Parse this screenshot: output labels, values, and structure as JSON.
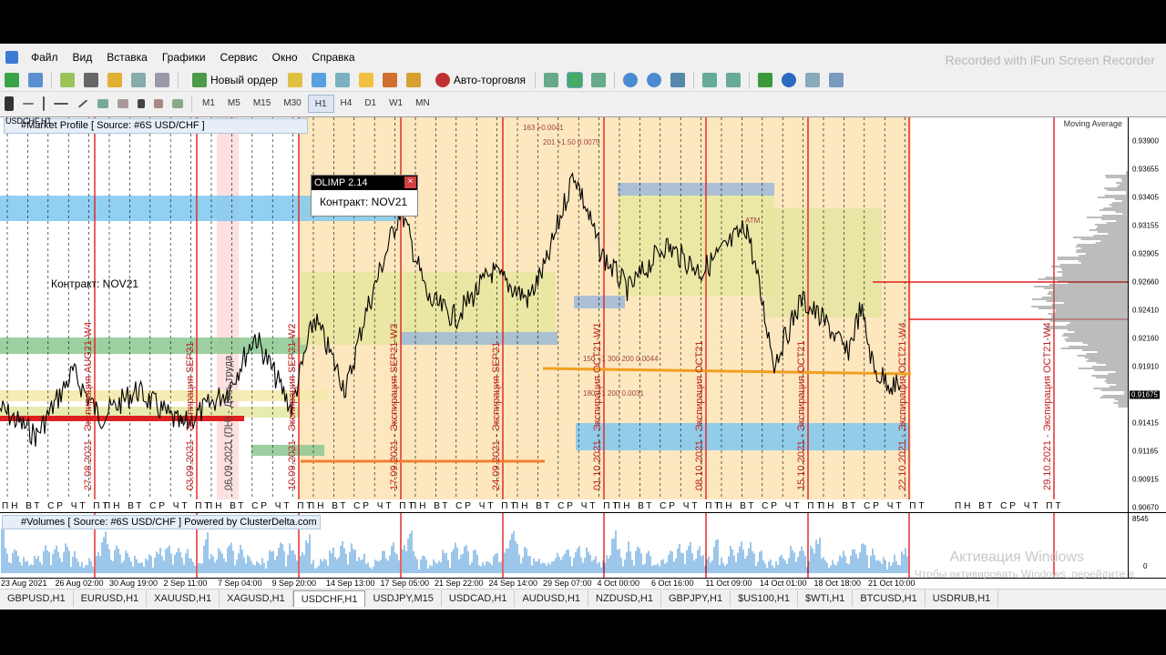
{
  "watermark": "Recorded with iFun Screen Recorder",
  "menu": [
    "Файл",
    "Вид",
    "Вставка",
    "Графики",
    "Сервис",
    "Окно",
    "Справка"
  ],
  "toolbar": {
    "new_order": "Новый ордер",
    "auto_trading": "Авто-торговля"
  },
  "timeframes": [
    "M1",
    "M5",
    "M15",
    "M30",
    "H1",
    "H4",
    "D1",
    "W1",
    "MN"
  ],
  "active_timeframe": "H1",
  "chart_symbol": "USDCHF,H1",
  "market_profile_title": "#Market Profile [ Source: #6S USD/CHF ]",
  "olimp": {
    "title": "OLIMP 2.14",
    "contract": "Контракт: NOV21"
  },
  "contract_label_left": "Контракт: NOV21",
  "moving_average_label": "Moving Average",
  "volumes_title": "#Volumes [ Source: #6S USD/CHF ] Powered by ClusterDelta.com",
  "price_labels": [
    "0.93900",
    "0.93655",
    "0.93405",
    "0.93155",
    "0.92905",
    "0.92660",
    "0.92410",
    "0.92160",
    "0.91910",
    "0.91675",
    "0.91415",
    "0.91165",
    "0.90915",
    "0.90670"
  ],
  "current_price": "0.91675",
  "volume_axis": {
    "max": "8545",
    "min": "0"
  },
  "time_labels": [
    "23 Aug 2021",
    "26 Aug 02:00",
    "30 Aug 19:00",
    "2 Sep 11:00",
    "7 Sep 04:00",
    "9 Sep 20:00",
    "14 Sep 13:00",
    "17 Sep 05:00",
    "21 Sep 22:00",
    "24 Sep 14:00",
    "29 Sep 07:00",
    "4 Oct 00:00",
    "6 Oct 16:00",
    "11 Oct 09:00",
    "14 Oct 01:00",
    "18 Oct 18:00",
    "21 Oct 10:00"
  ],
  "weekday_row": "ПН ВТ СР ЧТ ПТ",
  "vertical_labels": [
    "27.08.2021 - Экспирация AUG21-W4",
    "03.09.2021 - Экспирация SEP21",
    "06.09.2021 (ПН) - День труда",
    "10.09.2021 - Экспирация SEP21-W2",
    "17.09.2021 - Экспирация SEP21-W3",
    "24.09.2021 - Экспирация SEP21",
    "01.10.2021 - Экспирация OCT21-W1",
    "08.10.2021 - Экспирация OCT21",
    "15.10.2021 - Экспирация OCT21",
    "22.10.2021 - Экспирация OCT21-W4",
    "29.10.2021 - Экспирация OCT21-W4"
  ],
  "level_notes": [
    "163 +0.0041",
    "201 +1.50 0.0075",
    "ATM",
    "150 +1 300 200 0.0044",
    "180 +1 200 0.0031"
  ],
  "tabs": [
    "GBPUSD,H1",
    "EURUSD,H1",
    "XAUUSD,H1",
    "XAGUSD,H1",
    "USDCHF,H1",
    "USDJPY,M15",
    "USDCAD,H1",
    "AUDUSD,H1",
    "NZDUSD,H1",
    "GBPJPY,H1",
    "$US100,H1",
    "$WTI,H1",
    "BTCUSD,H1",
    "USDRUB,H1"
  ],
  "active_tab": "USDCHF,H1",
  "windows_activation": {
    "line1": "Активация Windows",
    "line2": "Чтобы активировать Windows, перейдите в"
  },
  "colors": {
    "orange_zone": "#fde7bf",
    "blue_zone": "#7ec8f0",
    "green_zone": "#8cc890",
    "red_line": "#e02020",
    "price_line": "#000000",
    "volume": "#3b8fd6"
  }
}
